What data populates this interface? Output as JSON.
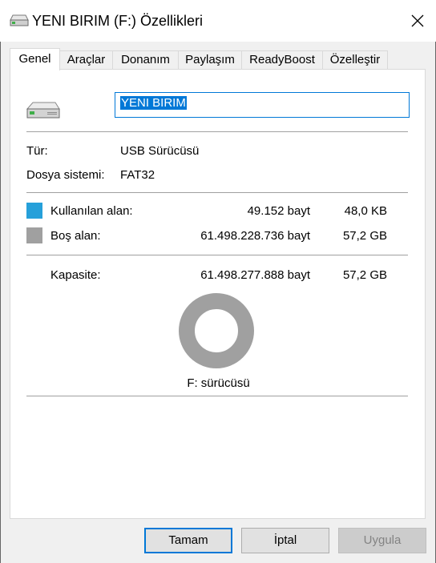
{
  "window": {
    "title": "YENI BIRIM (F:) Özellikleri"
  },
  "tabs": [
    {
      "label": "Genel",
      "active": true
    },
    {
      "label": "Araçlar"
    },
    {
      "label": "Donanım"
    },
    {
      "label": "Paylaşım"
    },
    {
      "label": "ReadyBoost"
    },
    {
      "label": "Özelleştir"
    }
  ],
  "general": {
    "volume_name": "YENI BIRIM",
    "type_label": "Tür:",
    "type_value": "USB Sürücüsü",
    "fs_label": "Dosya sistemi:",
    "fs_value": "FAT32",
    "used": {
      "label": "Kullanılan alan:",
      "bytes": "49.152 bayt",
      "size": "48,0 KB",
      "color": "#26a0da"
    },
    "free": {
      "label": "Boş alan:",
      "bytes": "61.498.228.736 bayt",
      "size": "57,2 GB",
      "color": "#a0a0a0"
    },
    "capacity": {
      "label": "Kapasite:",
      "bytes": "61.498.277.888 bayt",
      "size": "57,2 GB"
    },
    "used_fraction": 8e-07,
    "drive_caption": "F: sürücüsü"
  },
  "buttons": {
    "ok": "Tamam",
    "cancel": "İptal",
    "apply": "Uygula"
  }
}
